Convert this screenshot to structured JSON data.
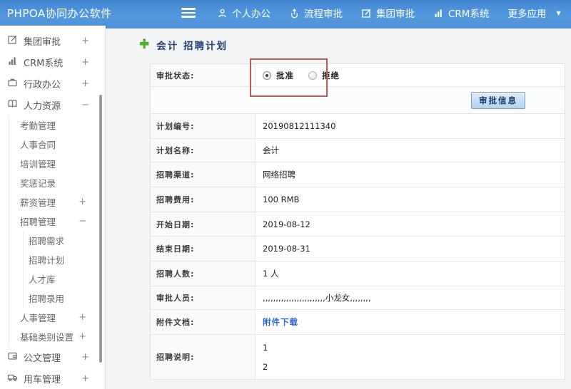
{
  "colors": {
    "accent": "#4e93da",
    "annotation_red": "#c05a56",
    "link_blue": "#2a6bc8",
    "plus_green": "#54b437",
    "title_navy": "#1f4071"
  },
  "header": {
    "brand": "PHPOA协同办公软件",
    "nav": [
      {
        "label": "个人办公",
        "icon": "person-icon"
      },
      {
        "label": "流程审批",
        "icon": "process-approval-icon"
      },
      {
        "label": "集团审批",
        "icon": "group-approval-icon"
      },
      {
        "label": "CRM系统",
        "icon": "crm-chart-icon"
      },
      {
        "label": "更多应用",
        "icon": "caret-down-icon"
      }
    ]
  },
  "sidebar": {
    "items": [
      {
        "label": "集团审批",
        "toggle": "+",
        "level": 1,
        "icon": "edit-square-icon"
      },
      {
        "label": "CRM系统",
        "toggle": "+",
        "level": 1,
        "icon": "bar-chart-icon"
      },
      {
        "label": "行政办公",
        "toggle": "+",
        "level": 1,
        "icon": "briefcase-icon"
      },
      {
        "label": "人力资源",
        "toggle": "−",
        "level": 1,
        "icon": "book-icon"
      },
      {
        "label": "考勤管理",
        "toggle": "",
        "level": 2
      },
      {
        "label": "人事合同",
        "toggle": "",
        "level": 2
      },
      {
        "label": "培训管理",
        "toggle": "",
        "level": 2
      },
      {
        "label": "奖惩记录",
        "toggle": "",
        "level": 2
      },
      {
        "label": "薪资管理",
        "toggle": "+",
        "level": 2
      },
      {
        "label": "招聘管理",
        "toggle": "−",
        "level": 2
      },
      {
        "label": "招聘需求",
        "toggle": "",
        "level": 3
      },
      {
        "label": "招聘计划",
        "toggle": "",
        "level": 3
      },
      {
        "label": "人才库",
        "toggle": "",
        "level": 3
      },
      {
        "label": "招聘录用",
        "toggle": "",
        "level": 3
      },
      {
        "label": "人事管理",
        "toggle": "+",
        "level": 2
      },
      {
        "label": "基础类别设置",
        "toggle": "+",
        "level": 2
      },
      {
        "label": "公文管理",
        "toggle": "+",
        "level": 1,
        "icon": "document-icon"
      },
      {
        "label": "用车管理",
        "toggle": "+",
        "level": 1,
        "icon": "truck-icon"
      }
    ]
  },
  "main": {
    "page_title": "会计 招聘计划",
    "approval": {
      "label": "审批状态:",
      "options": [
        {
          "label": "批准",
          "checked": true
        },
        {
          "label": "拒绝",
          "checked": false
        }
      ],
      "button_label": "审批信息"
    },
    "fields": [
      {
        "label": "计划编号:",
        "value": "20190812111340"
      },
      {
        "label": "计划名称:",
        "value": "会计"
      },
      {
        "label": "招聘渠道:",
        "value": "网络招聘"
      },
      {
        "label": "招聘费用:",
        "value": "100 RMB"
      },
      {
        "label": "开始日期:",
        "value": "2019-08-12"
      },
      {
        "label": "结束日期:",
        "value": "2019-08-31"
      },
      {
        "label": "招聘人数:",
        "value": "1 人"
      },
      {
        "label": "审批人员:",
        "value": ",,,,,,,,,,,,,,,,,,,,,,,,小龙女,,,,,,,,"
      }
    ],
    "attachment": {
      "label": "附件文档:",
      "link_text": "附件下载"
    },
    "description": {
      "label": "招聘说明:",
      "lines": [
        "1",
        "2"
      ]
    }
  }
}
